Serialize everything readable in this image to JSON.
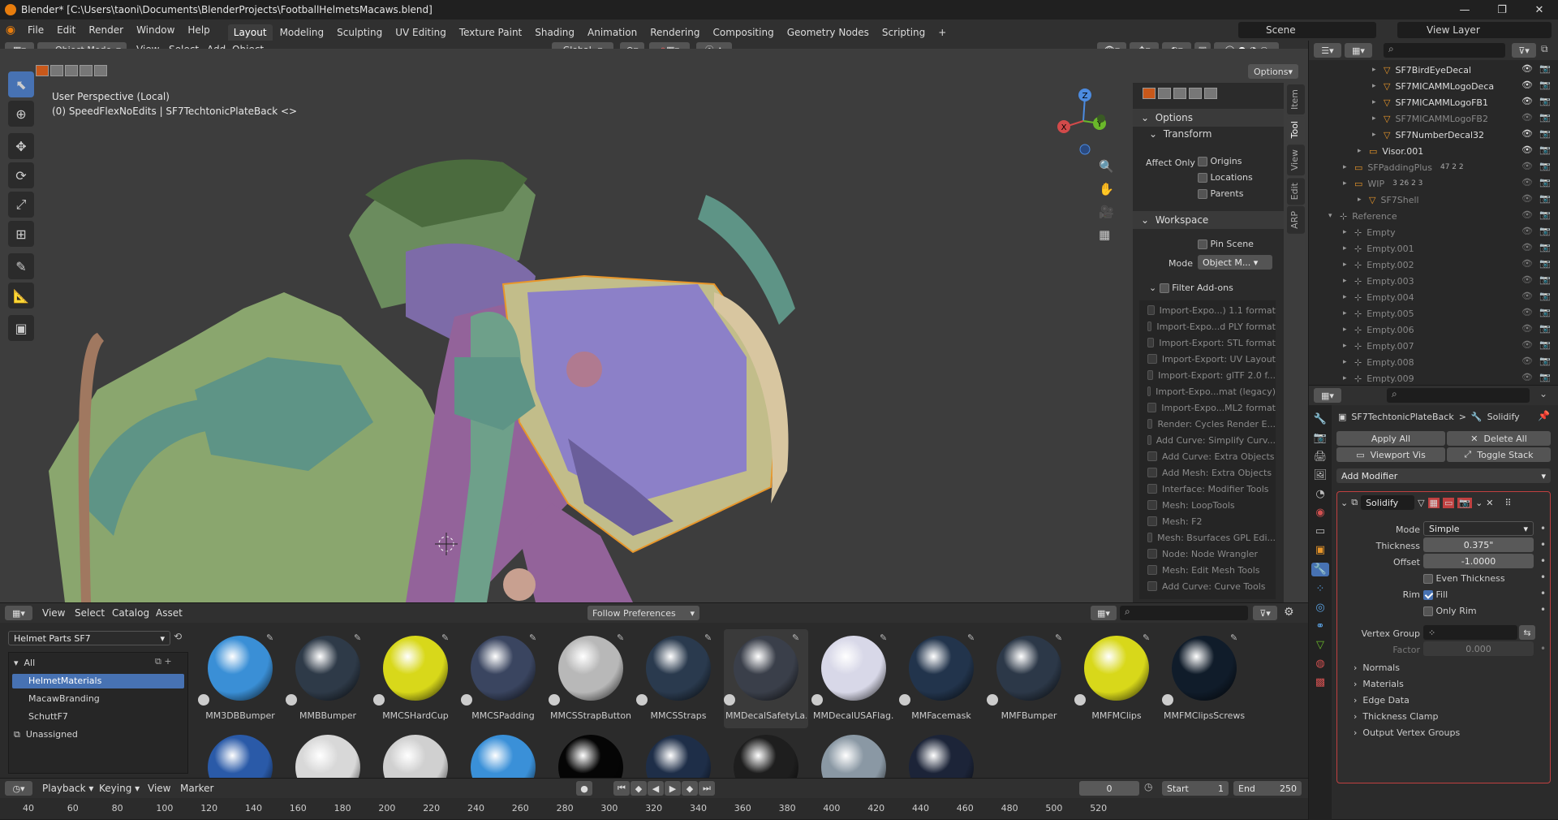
{
  "window": {
    "title": "Blender* [C:\\Users\\taoni\\Documents\\BlenderProjects\\FootballHelmetsMacaws.blend]",
    "minimize": "—",
    "maximize": "❐",
    "close": "✕"
  },
  "menu": [
    "File",
    "Edit",
    "Render",
    "Window",
    "Help"
  ],
  "workspaces": [
    "Layout",
    "Modeling",
    "Sculpting",
    "UV Editing",
    "Texture Paint",
    "Shading",
    "Animation",
    "Rendering",
    "Compositing",
    "Geometry Nodes",
    "Scripting"
  ],
  "add_tab": "+",
  "scene": {
    "label": "Scene",
    "view_layer": "View Layer"
  },
  "header3d": {
    "mode": "Object Mode",
    "menus": [
      "View",
      "Select",
      "Add",
      "Object"
    ],
    "transform": "Global",
    "options": "Options"
  },
  "viewport": {
    "perspective": "User Perspective (Local)",
    "object_info": "(0) SpeedFlexNoEdits | SF7TechtonicPlateBack <>"
  },
  "gizmo": {
    "x": "X",
    "y": "Y",
    "z": "Z"
  },
  "npanel": {
    "tabs": [
      "Item",
      "Tool",
      "View",
      "Edit",
      "ARP"
    ],
    "options_header": "Options",
    "transform_header": "Transform",
    "affect_only": "Affect Only",
    "origins": "Origins",
    "locations": "Locations",
    "parents": "Parents",
    "workspace_header": "Workspace",
    "pin_scene": "Pin Scene",
    "mode_label": "Mode",
    "mode_value": "Object M...",
    "filter_addons": "Filter Add-ons",
    "addons": [
      "Import-Expo...) 1.1 format",
      "Import-Expo...d PLY format",
      "Import-Export: STL format",
      "Import-Export: UV Layout",
      "Import-Export: glTF 2.0 f...",
      "Import-Expo...mat (legacy)",
      "Import-Expo...ML2 format",
      "Render: Cycles Render E...",
      "Add Curve: Simplify Curv...",
      "Add Curve: Extra Objects",
      "Add Mesh: Extra Objects",
      "Interface: Modifier Tools",
      "Mesh: LoopTools",
      "Mesh: F2",
      "Mesh: Bsurfaces GPL Edi...",
      "Node: Node Wrangler",
      "Mesh: Edit Mesh Tools",
      "Add Curve: Curve Tools"
    ]
  },
  "outliner": {
    "rows": [
      {
        "name": "SF7BirdEyeDecal",
        "indent": 3,
        "dim": false
      },
      {
        "name": "SF7MICAMMLogoDeca",
        "indent": 3,
        "dim": false
      },
      {
        "name": "SF7MICAMMLogoFB1",
        "indent": 3,
        "dim": false
      },
      {
        "name": "SF7MICAMMLogoFB2",
        "indent": 3,
        "dim": true
      },
      {
        "name": "SF7NumberDecal32",
        "indent": 3,
        "dim": false
      },
      {
        "name": "Visor.001",
        "indent": 2,
        "dim": false
      },
      {
        "name": "SFPaddingPlus",
        "indent": 1,
        "dim": true,
        "badges": "47  2  2"
      },
      {
        "name": "WIP",
        "indent": 1,
        "dim": true,
        "badges": "3  26  2  3"
      },
      {
        "name": "SF7Shell",
        "indent": 2,
        "dim": true
      },
      {
        "name": "Reference",
        "indent": 0,
        "dim": true
      },
      {
        "name": "Empty",
        "indent": 1,
        "dim": true
      },
      {
        "name": "Empty.001",
        "indent": 1,
        "dim": true
      },
      {
        "name": "Empty.002",
        "indent": 1,
        "dim": true
      },
      {
        "name": "Empty.003",
        "indent": 1,
        "dim": true
      },
      {
        "name": "Empty.004",
        "indent": 1,
        "dim": true
      },
      {
        "name": "Empty.005",
        "indent": 1,
        "dim": true
      },
      {
        "name": "Empty.006",
        "indent": 1,
        "dim": true
      },
      {
        "name": "Empty.007",
        "indent": 1,
        "dim": true
      },
      {
        "name": "Empty.008",
        "indent": 1,
        "dim": true
      },
      {
        "name": "Empty.009",
        "indent": 1,
        "dim": true
      }
    ]
  },
  "properties": {
    "breadcrumb_object": "SF7TechtonicPlateBack",
    "breadcrumb_sep": ">",
    "breadcrumb_modifier": "Solidify",
    "apply_all": "Apply All",
    "delete_all": "Delete All",
    "viewport_vis": "Viewport Vis",
    "toggle_stack": "Toggle Stack",
    "add_modifier": "Add Modifier",
    "modifier_name": "Solidify",
    "mode_label": "Mode",
    "mode_value": "Simple",
    "thickness_label": "Thickness",
    "thickness_value": "0.375\"",
    "offset_label": "Offset",
    "offset_value": "-1.0000",
    "even_thickness": "Even Thickness",
    "rim_label": "Rim",
    "fill": "Fill",
    "only_rim": "Only Rim",
    "vertex_group_label": "Vertex Group",
    "factor_label": "Factor",
    "factor_value": "0.000",
    "subpanels": [
      "Normals",
      "Materials",
      "Edge Data",
      "Thickness Clamp",
      "Output Vertex Groups"
    ]
  },
  "asset_browser": {
    "menus": [
      "View",
      "Select",
      "Catalog",
      "Asset"
    ],
    "library": "Helmet Parts SF7",
    "import_method": "Follow Preferences",
    "catalog_all": "All",
    "catalogs": [
      "HelmetMaterials",
      "MacawBranding",
      "SchuttF7",
      "Unassigned"
    ],
    "materials": [
      {
        "name": "MM3DBBumper",
        "color": "#3a8fd6"
      },
      {
        "name": "MMBBumper",
        "color": "#2e3a48"
      },
      {
        "name": "MMCSHardCup",
        "color": "#d8d81a"
      },
      {
        "name": "MMCSPadding",
        "color": "#3a4560"
      },
      {
        "name": "MMCSStrapButtons",
        "color": "#b8b8b8"
      },
      {
        "name": "MMCSStraps",
        "color": "#2a3a4e"
      },
      {
        "name": "MMDecalSafetyLa...",
        "color": "#3a3f4a"
      },
      {
        "name": "MMDecalUSAFlag...",
        "color": "#d8d8e8"
      },
      {
        "name": "MMFacemask",
        "color": "#22344c"
      },
      {
        "name": "MMFBumper",
        "color": "#2c3848"
      },
      {
        "name": "MMFMClips",
        "color": "#d8d81a"
      },
      {
        "name": "MMFMClipsScrews",
        "color": "#101c2a"
      }
    ],
    "materials_row2": [
      "#2a5aa8",
      "#d8d8d8",
      "#d0d0d0",
      "#3a90d8",
      "#050505",
      "#1e2e48",
      "#1e1e1e",
      "#8a98a4",
      "#1c2438"
    ]
  },
  "timeline": {
    "playback": "Playback",
    "keying": "Keying",
    "view": "View",
    "marker": "Marker",
    "current_frame": "0",
    "start_label": "Start",
    "start_value": "1",
    "end_label": "End",
    "end_value": "250",
    "ruler": [
      "40",
      "60",
      "80",
      "100",
      "120",
      "140",
      "160",
      "180",
      "200",
      "220",
      "240",
      "260",
      "280",
      "300",
      "320",
      "340",
      "360",
      "380",
      "400",
      "420",
      "440",
      "460",
      "480",
      "500",
      "520"
    ]
  }
}
